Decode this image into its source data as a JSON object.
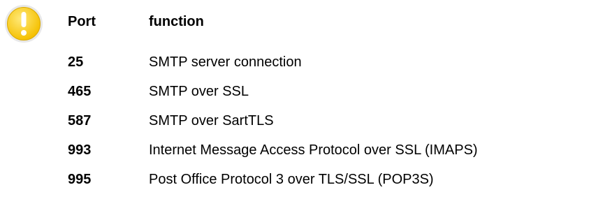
{
  "icon": {
    "name": "warning-icon",
    "colors": {
      "fill": "#f5c000",
      "fill_light": "#ffe979",
      "ring": "#e8e8e8",
      "mark": "#ffffff"
    }
  },
  "table": {
    "headers": {
      "port": "Port",
      "function": "function"
    },
    "rows": [
      {
        "port": "25",
        "function": "SMTP server connection"
      },
      {
        "port": "465",
        "function": "SMTP over SSL"
      },
      {
        "port": "587",
        "function": "SMTP over SartTLS"
      },
      {
        "port": "993",
        "function": "Internet Message Access Protocol over SSL (IMAPS)"
      },
      {
        "port": "995",
        "function": "Post Office Protocol 3 over TLS/SSL (POP3S)"
      }
    ]
  }
}
